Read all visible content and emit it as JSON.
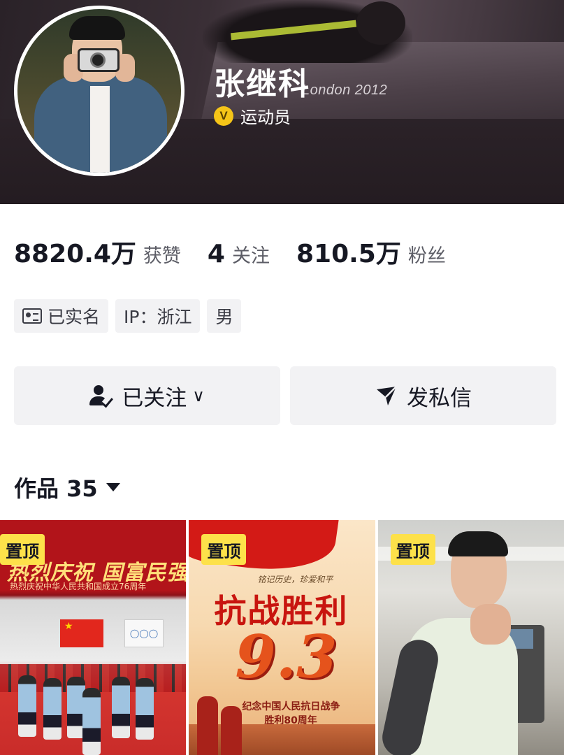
{
  "profile": {
    "name": "张继科",
    "verify_badge": "V",
    "verify_label": "运动员",
    "banner_text": "London 2012"
  },
  "stats": [
    {
      "value": "8820.4万",
      "label": "获赞"
    },
    {
      "value": "4",
      "label": "关注"
    },
    {
      "value": "810.5万",
      "label": "粉丝"
    }
  ],
  "tags": [
    {
      "label": "已实名",
      "icon": "id-card-icon"
    },
    {
      "label": "IP：浙江"
    },
    {
      "label": "男"
    }
  ],
  "actions": {
    "follow_label": "已关注",
    "follow_chevron": "∨",
    "message_label": "发私信"
  },
  "works": {
    "label": "作品 35"
  },
  "videos": [
    {
      "pinned": "置顶",
      "headline": "热烈庆祝 国富民强",
      "subline": "热烈庆祝中华人民共和国成立76周年",
      "rings": "◯◯◯"
    },
    {
      "pinned": "置顶",
      "small": "铭记历史，珍爱和平",
      "headline": "抗战胜利",
      "number": "9.3",
      "caption1": "纪念中国人民抗日战争",
      "caption2": "胜利80周年"
    },
    {
      "pinned": "置顶"
    }
  ],
  "colors": {
    "accent_yellow": "#fde14a",
    "verify_gold": "#f5c518",
    "button_bg": "#f2f2f4",
    "text_primary": "#161823"
  }
}
